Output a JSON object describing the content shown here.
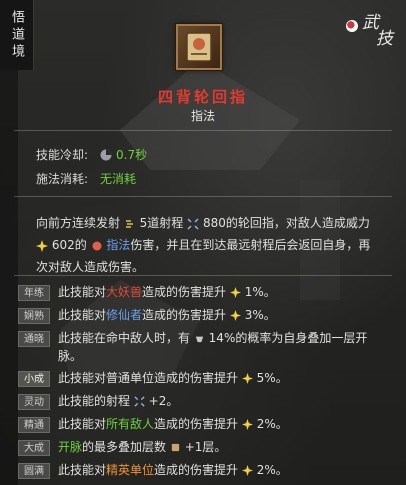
{
  "side_tab": {
    "label": "悟道境"
  },
  "corner_logo": {
    "char1": "武",
    "char2": "技"
  },
  "skill": {
    "name": "四背轮回指",
    "type": "指法"
  },
  "stats": {
    "cooldown_label": "技能冷却:",
    "cooldown_value": "0.7秒",
    "cost_label": "施法消耗:",
    "cost_value": "无消耗"
  },
  "description": {
    "p1": "向前方连续发射",
    "p2": "5道射程",
    "p3": "880的轮回指，对敌人造成威力",
    "p4": "602的",
    "p5": "指法",
    "p6": "伤害，并且在到达最远射程后会返回自身，再次对敌人造成伤害。"
  },
  "upgrades": [
    {
      "badge": "年练",
      "pre": "此技能对",
      "hl": "大妖兽",
      "post": "造成的伤害提升",
      "val": "1%。",
      "color": "red"
    },
    {
      "badge": "娴熟",
      "pre": "此技能对",
      "hl": "修仙者",
      "post": "造成的伤害提升",
      "val": "3%。",
      "color": "blue"
    },
    {
      "badge": "通晓",
      "pre": "",
      "hl": "此技能在命中敌人时，有",
      "post": "14%的概率为自身叠加一层开脉。",
      "val": "",
      "color": "orange"
    },
    {
      "badge": "小成",
      "pre": "",
      "hl": "此技能对普通单位造成的伤害提升",
      "post": "",
      "val": "5%。",
      "color": "green"
    },
    {
      "badge": "灵动",
      "pre": "此技能的射程",
      "hl": "",
      "post": "",
      "val": "+2。",
      "color": ""
    },
    {
      "badge": "精通",
      "pre": "此技能对",
      "hl": "所有敌人",
      "post": "造成的伤害提升",
      "val": "2%。",
      "color": "green"
    },
    {
      "badge": "大成",
      "pre": "",
      "hl": "开脉",
      "post": "的最多叠加层数",
      "val": "+1层。",
      "color": "green"
    },
    {
      "badge": "圆满",
      "pre": "此技能对",
      "hl": "精英单位",
      "post": "造成的伤害提升",
      "val": "2%。",
      "color": "orange"
    }
  ],
  "colors": {
    "title_red": "#e23a2e",
    "green": "#6ed23c",
    "blue": "#6aa0e8",
    "orange": "#f0932e"
  }
}
